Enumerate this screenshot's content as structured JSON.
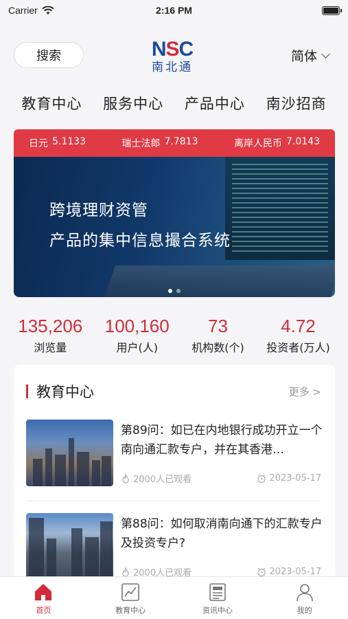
{
  "status_bar": {
    "carrier": "Carrier",
    "time": "2:16 PM"
  },
  "header": {
    "search_label": "搜索",
    "logo_main_a": "N",
    "logo_main_b": "S",
    "logo_main_c": "C",
    "logo_sub": "南北通",
    "language": "简体"
  },
  "top_nav": [
    "教育中心",
    "服务中心",
    "产品中心",
    "南沙招商"
  ],
  "ticker": [
    {
      "name": "日元",
      "value": "5.1133"
    },
    {
      "name": "瑞士法郎",
      "value": "7.7813"
    },
    {
      "name": "离岸人民币",
      "value": "7.0143"
    }
  ],
  "banner": {
    "line1": "跨境理财资管",
    "line2": "产品的集中信息撮合系统"
  },
  "stats": [
    {
      "value": "135,206",
      "label": "浏览量"
    },
    {
      "value": "100,160",
      "label": "用户(人)"
    },
    {
      "value": "73",
      "label": "机构数(个)"
    },
    {
      "value": "4.72",
      "label": "投资者(万人)"
    }
  ],
  "education": {
    "title": "教育中心",
    "more": "更多 >",
    "articles": [
      {
        "title": "第89问：如已在内地银行成功开立一个南向通汇款专户，并在其香港…",
        "views": "2000人已观看",
        "date": "2023-05-17"
      },
      {
        "title": "第88问：如何取消南向通下的汇款专户及投资专户?",
        "views": "2000人已观看",
        "date": "2023-05-17"
      }
    ]
  },
  "tabbar": [
    {
      "label": "首页",
      "icon": "home-icon",
      "active": true
    },
    {
      "label": "教育中心",
      "icon": "chart-icon",
      "active": false
    },
    {
      "label": "资讯中心",
      "icon": "news-icon",
      "active": false
    },
    {
      "label": "我的",
      "icon": "user-icon",
      "active": false
    }
  ],
  "colors": {
    "accent": "#d42b3a",
    "brand_blue": "#1a4b9c",
    "ticker_bg": "#e03a45"
  }
}
